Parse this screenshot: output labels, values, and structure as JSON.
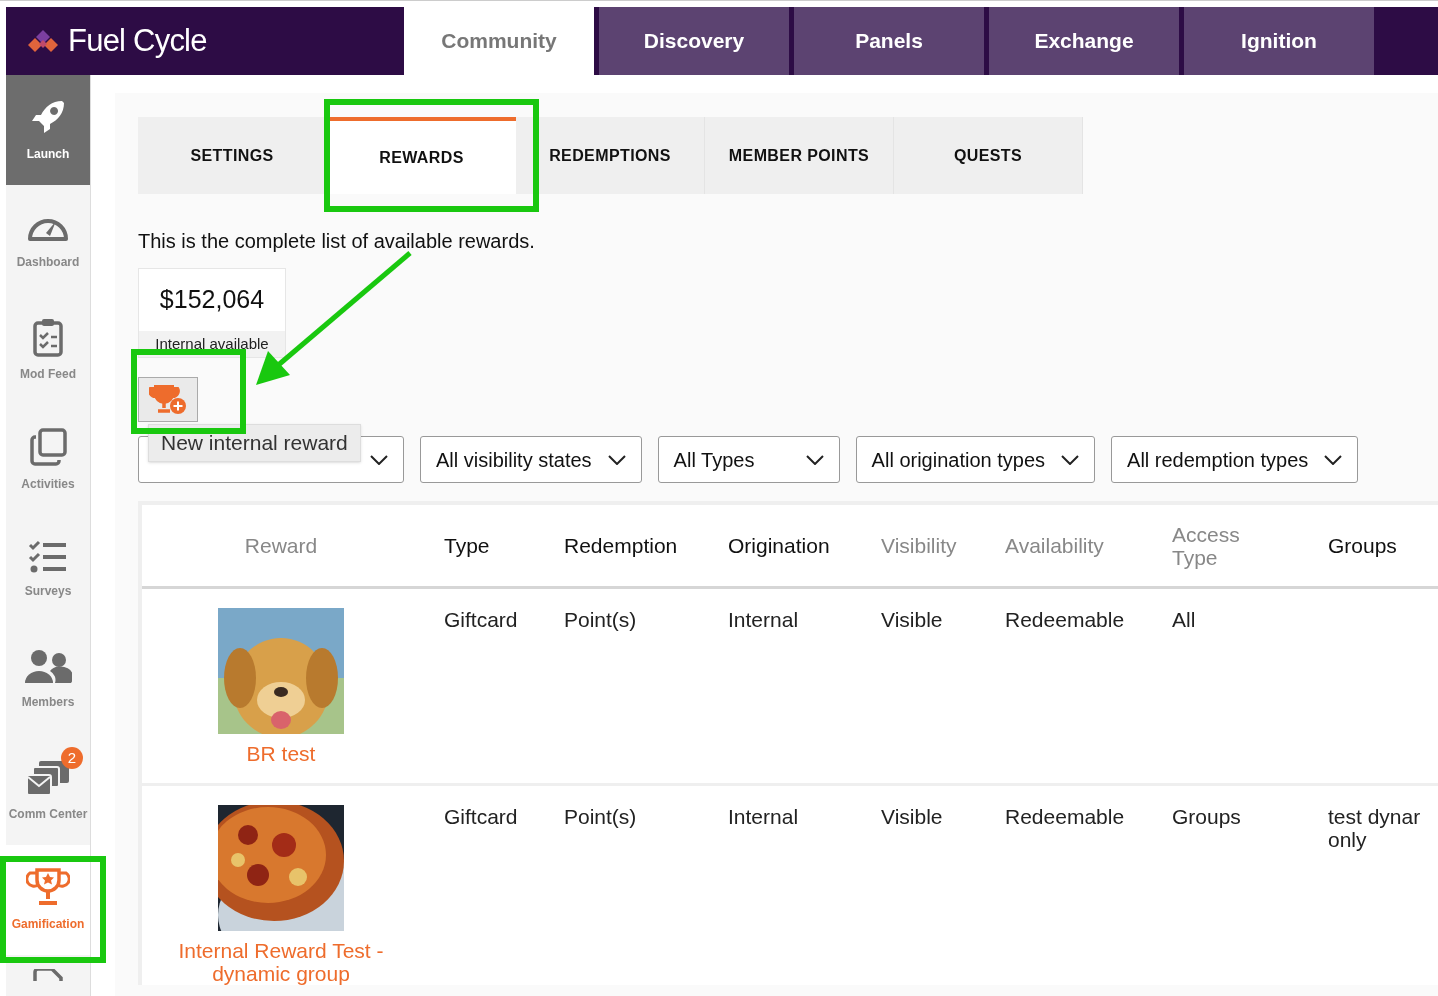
{
  "brand": {
    "name": "Fuel Cycle"
  },
  "top_tabs": [
    {
      "label": "Community",
      "selected": true
    },
    {
      "label": "Discovery",
      "selected": false
    },
    {
      "label": "Panels",
      "selected": false
    },
    {
      "label": "Exchange",
      "selected": false
    },
    {
      "label": "Ignition",
      "selected": false
    }
  ],
  "sidebar": {
    "items": [
      {
        "label": "Launch",
        "kind": "launch",
        "selected": false
      },
      {
        "label": "Dashboard",
        "kind": "dashboard",
        "selected": false
      },
      {
        "label": "Mod Feed",
        "kind": "modfeed",
        "selected": false
      },
      {
        "label": "Activities",
        "kind": "activities",
        "selected": false
      },
      {
        "label": "Surveys",
        "kind": "surveys",
        "selected": false
      },
      {
        "label": "Members",
        "kind": "members",
        "selected": false
      },
      {
        "label": "Comm Center",
        "kind": "comm",
        "selected": false,
        "badge": "2"
      },
      {
        "label": "Gamification",
        "kind": "gamification",
        "selected": true
      }
    ]
  },
  "sub_tabs": [
    {
      "label": "SETTINGS",
      "selected": false
    },
    {
      "label": "REWARDS",
      "selected": true
    },
    {
      "label": "REDEMPTIONS",
      "selected": false
    },
    {
      "label": "MEMBER POINTS",
      "selected": false
    },
    {
      "label": "QUESTS",
      "selected": false
    }
  ],
  "intro": "This is the complete list of available rewards.",
  "balance": {
    "amount": "$152,064",
    "label": "Internal available"
  },
  "tooltip": "New internal reward",
  "filters": [
    {
      "kind": "covered"
    },
    {
      "label": "All visibility states"
    },
    {
      "label": "All Types"
    },
    {
      "label": "All origination types"
    },
    {
      "label": "All redemption types"
    }
  ],
  "table": {
    "columns": [
      {
        "label": "Reward",
        "muted": true
      },
      {
        "label": "Type",
        "muted": false
      },
      {
        "label": "Redemption",
        "muted": false
      },
      {
        "label": "Origination",
        "muted": false
      },
      {
        "label": "Visibility",
        "muted": true
      },
      {
        "label": "Availability",
        "muted": true
      },
      {
        "label": "Access Type",
        "muted": true
      },
      {
        "label": "Groups",
        "muted": false
      }
    ],
    "rows": [
      {
        "cells": [
          "BR test",
          "Giftcard",
          "Point(s)",
          "Internal",
          "Visible",
          "Redeemable",
          "All",
          ""
        ]
      },
      {
        "cells": [
          "Internal Reward Test - dynamic group",
          "Giftcard",
          "Point(s)",
          "Internal",
          "Visible",
          "Redeemable",
          "Groups",
          "test dynar only"
        ]
      }
    ]
  }
}
